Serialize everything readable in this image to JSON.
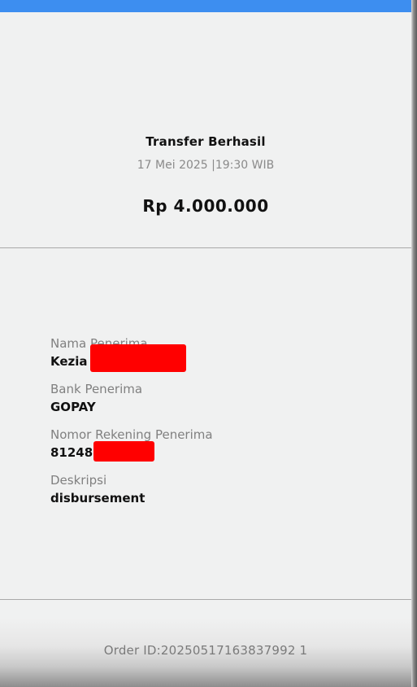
{
  "colors": {
    "top_bar": "#3d8ef0",
    "redaction": "#ff0000"
  },
  "receipt": {
    "title": "Transfer Berhasil",
    "datetime": "17 Mei 2025 |19:30 WIB",
    "amount": "Rp 4.000.000"
  },
  "details": {
    "recipient_name_label": "Nama Penerima",
    "recipient_name_value": "Kezia",
    "bank_label": "Bank Penerima",
    "bank_value": "GOPAY",
    "account_number_label": "Nomor Rekening Penerima",
    "account_number_value": "81248",
    "description_label": "Deskripsi",
    "description_value": "disbursement"
  },
  "footer": {
    "order_id": "Order ID:20250517163837992 1"
  }
}
